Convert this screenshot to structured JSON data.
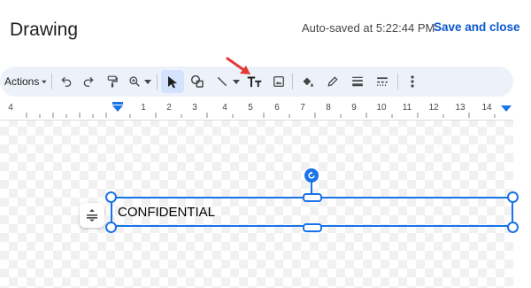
{
  "header": {
    "title": "Drawing",
    "autosave": "Auto-saved at 5:22:44 PM",
    "save_close": "Save and close"
  },
  "toolbar": {
    "actions_label": "Actions",
    "icons": [
      "undo-icon",
      "redo-icon",
      "paint-format-icon",
      "zoom-icon",
      "select-icon",
      "shape-icon",
      "line-icon",
      "text-box-icon",
      "image-icon",
      "fill-color-icon",
      "border-color-icon",
      "border-weight-icon",
      "border-dash-icon",
      "more-icon"
    ]
  },
  "ruler": {
    "labels": [
      "4",
      "1",
      "2",
      "3",
      "4",
      "5",
      "6",
      "7",
      "8",
      "9",
      "10",
      "11",
      "12",
      "13",
      "14"
    ]
  },
  "canvas": {
    "text_box_text": "CONFIDENTIAL"
  },
  "colors": {
    "accent": "#1a73e8",
    "link": "#0b57d0",
    "toolbar_bg": "#edf2fa",
    "annotation_arrow": "#e53935"
  }
}
